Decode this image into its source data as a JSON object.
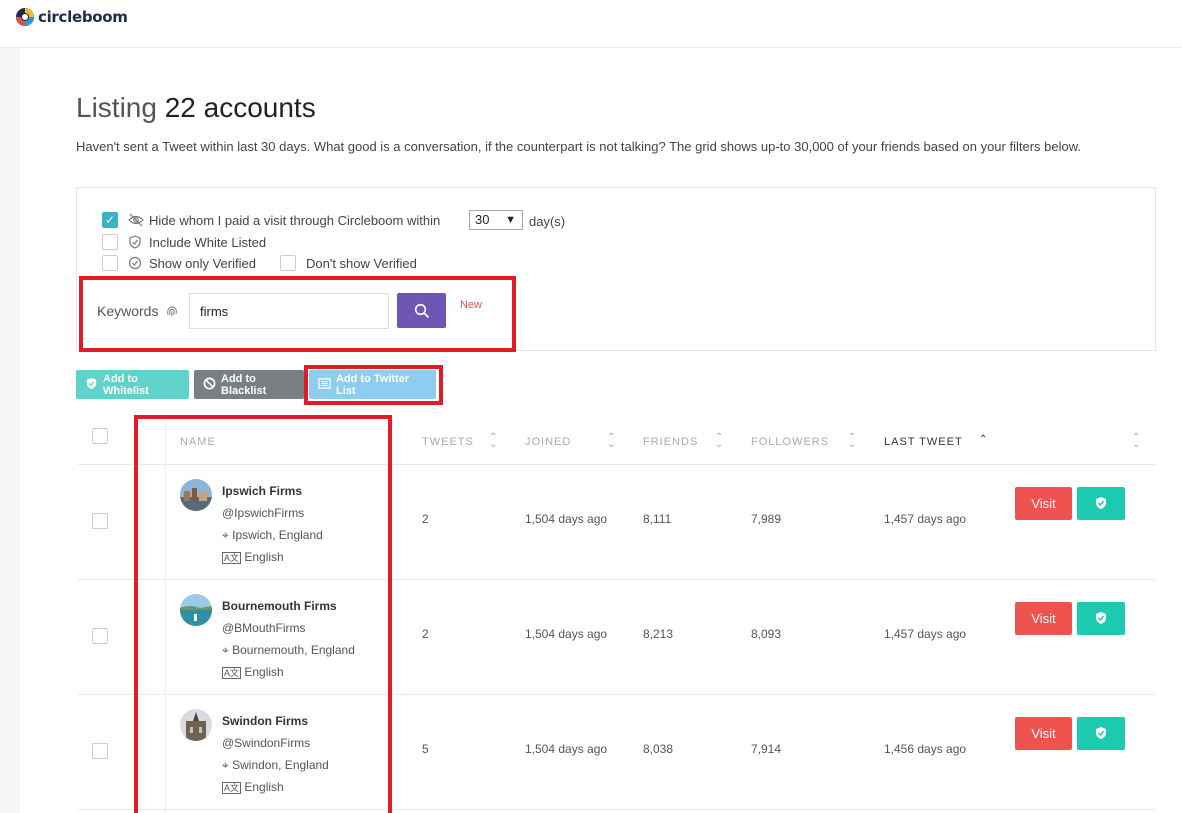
{
  "brand": {
    "name": "circleboom"
  },
  "page": {
    "title_prefix": "Listing",
    "title_count": "22 accounts",
    "description": "Haven't sent a Tweet within last 30 days. What good is a conversation, if the counterpart is not talking? The grid shows up-to 30,000 of your friends based on your filters below."
  },
  "filters": {
    "hide_visited": {
      "label": "Hide whom I paid a visit through Circleboom within",
      "checked": true
    },
    "days_select": {
      "value": "30",
      "suffix": "day(s)"
    },
    "include_white_listed": {
      "label": "Include White Listed",
      "checked": false
    },
    "only_verified": {
      "label": "Show only Verified",
      "checked": false
    },
    "dont_show_verified": {
      "label": "Don't show Verified",
      "checked": false
    },
    "keywords": {
      "label": "Keywords",
      "value": "firms",
      "new_tag": "New"
    }
  },
  "actions": {
    "whitelist": "Add to Whitelist",
    "blacklist": "Add to Blacklist",
    "twitter_list": "Add to Twitter List"
  },
  "table": {
    "columns": [
      "NAME",
      "TWEETS",
      "JOINED",
      "FRIENDS",
      "FOLLOWERS",
      "LAST TWEET"
    ],
    "visit_label": "Visit",
    "rows": [
      {
        "name": "Ipswich Firms",
        "handle": "@IpswichFirms",
        "location": "Ipswich, England",
        "language": "English",
        "tweets": "2",
        "joined": "1,504 days ago",
        "friends": "8,111",
        "followers": "7,989",
        "last_tweet": "1,457 days ago"
      },
      {
        "name": "Bournemouth Firms",
        "handle": "@BMouthFirms",
        "location": "Bournemouth, England",
        "language": "English",
        "tweets": "2",
        "joined": "1,504 days ago",
        "friends": "8,213",
        "followers": "8,093",
        "last_tweet": "1,457 days ago"
      },
      {
        "name": "Swindon Firms",
        "handle": "@SwindonFirms",
        "location": "Swindon, England",
        "language": "English",
        "tweets": "5",
        "joined": "1,504 days ago",
        "friends": "8,038",
        "followers": "7,914",
        "last_tweet": "1,456 days ago"
      }
    ]
  },
  "colors": {
    "visit": "#ef5350",
    "whitelist": "#1ccab0",
    "search": "#6d56b4",
    "highlight": "#e21c24"
  }
}
